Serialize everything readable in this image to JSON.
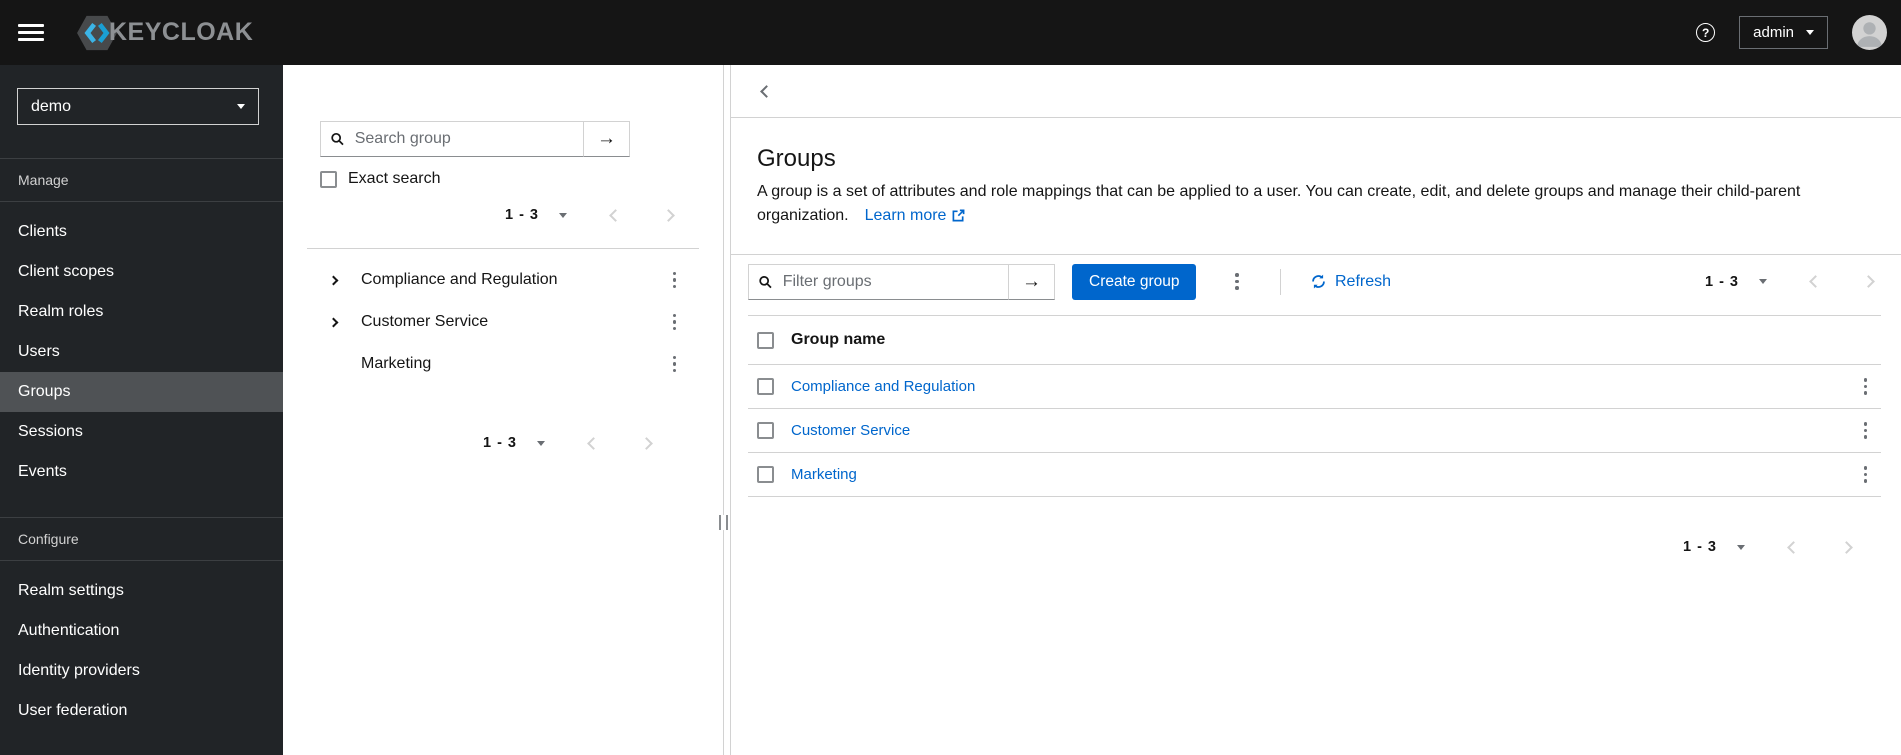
{
  "topbar": {
    "brand": "KEYCLOAK",
    "help_icon_glyph": "?",
    "user_menu": {
      "label": "admin"
    }
  },
  "sidebar": {
    "realm_selector": "demo",
    "sections": [
      {
        "label": "Manage",
        "items": [
          "Clients",
          "Client scopes",
          "Realm roles",
          "Users",
          "Groups",
          "Sessions",
          "Events"
        ],
        "selected_item": "Groups"
      },
      {
        "label": "Configure",
        "items": [
          "Realm settings",
          "Authentication",
          "Identity providers",
          "User federation"
        ]
      }
    ]
  },
  "group_tree_panel": {
    "search": {
      "placeholder": "Search group",
      "submit_glyph": "→"
    },
    "exact_search_label": "Exact search",
    "pagination_top": {
      "range": "1 - 3"
    },
    "items": [
      {
        "label": "Compliance and Regulation",
        "expandable": true
      },
      {
        "label": "Customer Service",
        "expandable": true
      },
      {
        "label": "Marketing",
        "expandable": false
      }
    ],
    "pagination_bottom": {
      "range": "1 - 3"
    }
  },
  "main": {
    "page_header": {
      "title": "Groups",
      "description": "A group is a set of attributes and role mappings that can be applied to a user. You can create, edit, and delete groups and manage their child-parent organization.",
      "learn_more_label": "Learn more"
    },
    "toolbar": {
      "filter": {
        "placeholder": "Filter groups",
        "submit_glyph": "→"
      },
      "create_button_label": "Create group",
      "refresh_label": "Refresh",
      "pagination": {
        "range": "1 - 3"
      }
    },
    "table": {
      "columns": [
        "Group name"
      ],
      "rows": [
        {
          "name": "Compliance and Regulation"
        },
        {
          "name": "Customer Service"
        },
        {
          "name": "Marketing"
        }
      ]
    },
    "pagination_bottom": {
      "range": "1 - 3"
    }
  },
  "colors": {
    "accent": "#0066cc",
    "link": "#0066cc",
    "masthead_bg": "#151515",
    "sidebar_bg": "#212427",
    "sidebar_selected_bg": "#4f5255",
    "border": "#d2d2d2",
    "muted": "#6a6e73"
  }
}
